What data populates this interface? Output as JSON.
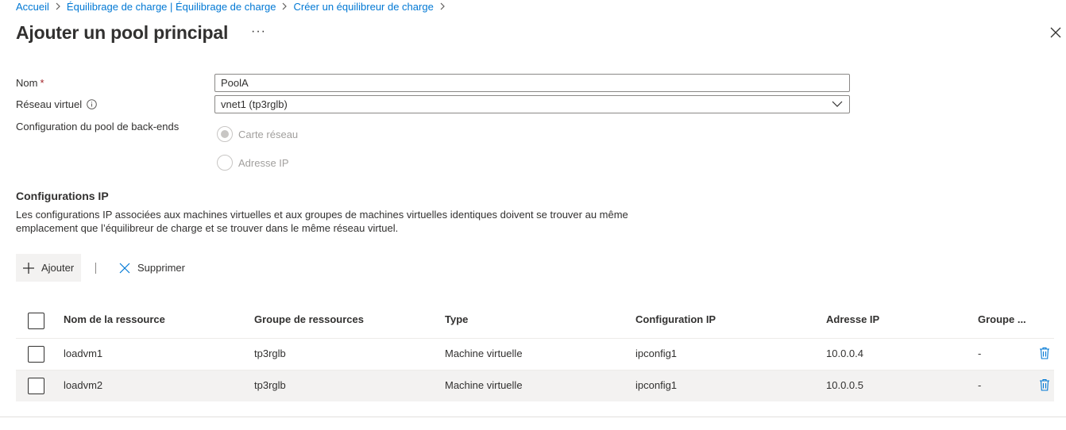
{
  "breadcrumb": [
    "Accueil",
    "Équilibrage de charge | Équilibrage de charge",
    "Créer un équilibreur de charge"
  ],
  "title": "Ajouter un pool principal",
  "more_label": "···",
  "form": {
    "name_label": "Nom",
    "required_mark": "*",
    "name_value": "PoolA",
    "vnet_label": "Réseau virtuel",
    "vnet_value": "vnet1 (tp3rglb)",
    "config_label": "Configuration du pool de back-ends",
    "options": [
      "Carte réseau",
      "Adresse IP"
    ],
    "selected_option": "Carte réseau"
  },
  "ip_section": {
    "title": "Configurations IP",
    "description": "Les configurations IP associées aux machines virtuelles et aux groupes de machines virtuelles identiques doivent se trouver au même emplacement que l’équilibreur de charge et se trouver dans le même réseau virtuel."
  },
  "toolbar": {
    "add_label": "Ajouter",
    "delete_label": "Supprimer"
  },
  "table": {
    "columns": [
      "Nom de la ressource",
      "Groupe de ressources",
      "Type",
      "Configuration IP",
      "Adresse IP",
      "Groupe ..."
    ],
    "rows": [
      [
        "loadvm1",
        "tp3rglb",
        "Machine virtuelle",
        "ipconfig1",
        "10.0.0.4",
        "-"
      ],
      [
        "loadvm2",
        "tp3rglb",
        "Machine virtuelle",
        "ipconfig1",
        "10.0.0.5",
        "-"
      ]
    ]
  },
  "colors": {
    "link": "#0078d4",
    "required": "#a4262c",
    "text": "#323130"
  }
}
